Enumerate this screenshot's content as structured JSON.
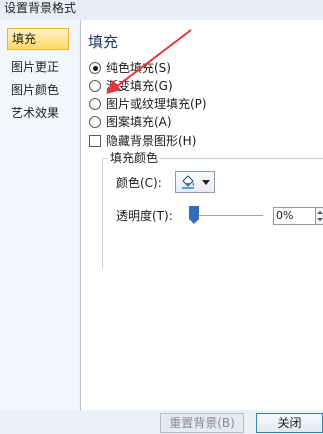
{
  "window": {
    "title": "设置背景格式"
  },
  "sidebar": {
    "items": [
      {
        "label": "填充",
        "selected": true
      },
      {
        "label": "图片更正",
        "selected": false
      },
      {
        "label": "图片颜色",
        "selected": false
      },
      {
        "label": "艺术效果",
        "selected": false
      }
    ]
  },
  "fill": {
    "section_title": "填充",
    "options": [
      {
        "label": "纯色填充(S)",
        "checked": true
      },
      {
        "label": "渐变填充(G)",
        "checked": false
      },
      {
        "label": "图片或纹理填充(P)",
        "checked": false
      },
      {
        "label": "图案填充(A)",
        "checked": false
      }
    ],
    "hide_graphics_label": "隐藏背景图形(H)",
    "hide_graphics_checked": false
  },
  "fill_color": {
    "group_title": "填充颜色",
    "color_label": "颜色(C):",
    "color_icon": "paint-bucket-icon",
    "transparency_label": "透明度(T):",
    "transparency_value": "0%",
    "transparency_level": 0
  },
  "buttons": {
    "reset_label": "重置背景(B)",
    "close_label": "关闭"
  },
  "colors": {
    "selection_fill": "#ffd965",
    "slider_thumb": "#2f6fbd",
    "annotation_arrow": "#e8333a"
  }
}
